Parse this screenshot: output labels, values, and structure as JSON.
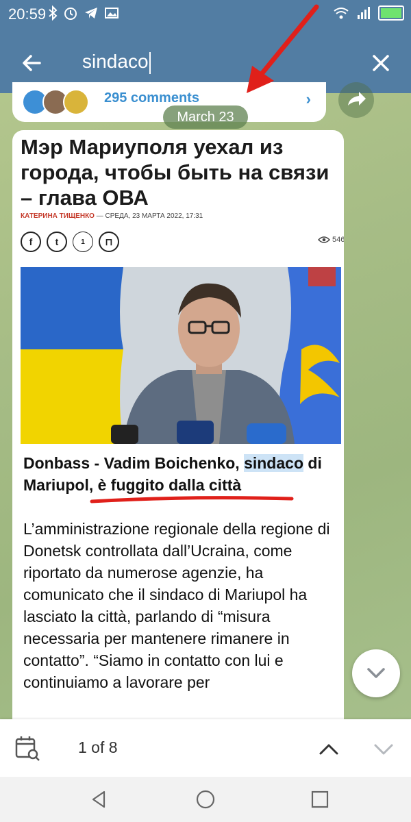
{
  "status_bar": {
    "time": "20:59",
    "icons_left": [
      "bluetooth-icon",
      "alarm-icon",
      "telegram-icon",
      "gallery-icon"
    ],
    "icons_right": [
      "wifi-icon",
      "signal-4g-icon",
      "battery-icon"
    ]
  },
  "search": {
    "query": "sindaco",
    "back_icon": "arrow-left-icon",
    "close_icon": "close-icon"
  },
  "previous_message": {
    "comments_label": "295 comments",
    "chevron": "›"
  },
  "date_separator": "March 23",
  "post": {
    "screenshot": {
      "headline": "Мэр Мариуполя уехал из города, чтобы быть на связи – глава ОВА",
      "author": "КАТЕРИНА ТИЩЕНКО",
      "meta": " — СРЕДА, 23 МАРТА 2022, 17:31",
      "social_icons": [
        "f",
        "t",
        "1",
        "⊓"
      ],
      "views": "546"
    },
    "title_plain": "Donbass - Vadim Boichenko, ",
    "title_highlight": "sindaco",
    "title_rest": " di Mariupol, è fuggito dalla città",
    "body": "L’amministrazione regionale della regione di Donetsk controllata dall’Ucraina, come riportato da numerose agenzie, ha comunicato che il sindaco di Mariupol ha lasciato la città, parlando di “misura necessaria per mantenere rimanere in contatto”. “Siamo in contatto con lui e continuiamo a lavorare per"
  },
  "results": {
    "counter": "1 of 8"
  },
  "colors": {
    "header": "#527da3",
    "link": "#3a8fd0",
    "highlight": "#cde3f6",
    "annotation_red": "#e0201a"
  }
}
